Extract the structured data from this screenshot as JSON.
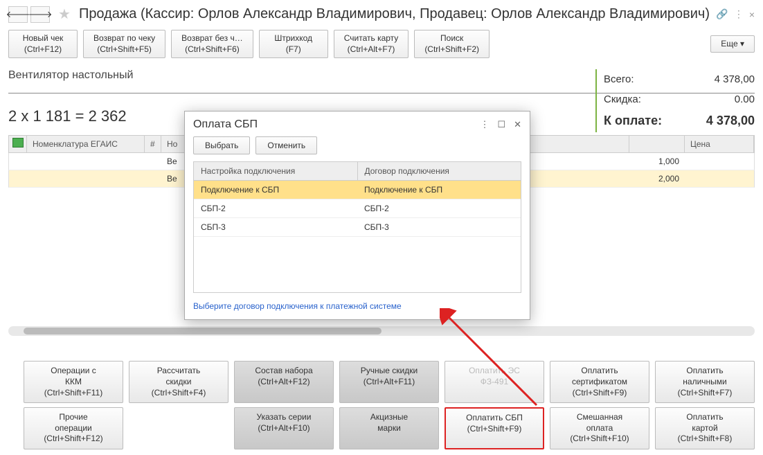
{
  "header": {
    "title": "Продажа (Кассир: Орлов Александр Владимирович, Продавец: Орлов Александр Владимирович)"
  },
  "toolbar": {
    "new_check": "Новый чек\n(Ctrl+F12)",
    "return_check": "Возврат по чеку\n(Ctrl+Shift+F5)",
    "return_no": "Возврат без ч…\n(Ctrl+Shift+F6)",
    "barcode": "Штрихкод\n(F7)",
    "card": "Считать карту\n(Ctrl+Alt+F7)",
    "search": "Поиск\n(Ctrl+Shift+F2)",
    "more": "Еще"
  },
  "item_name": "Вентилятор настольный",
  "calc": "2 x 1 181 = 2 362",
  "totals": {
    "total_label": "Всего:",
    "total_value": "4 378,00",
    "discount_label": "Скидка:",
    "discount_value": "0.00",
    "due_label": "К оплате:",
    "due_value": "4 378,00"
  },
  "table": {
    "col_nom": "Номенклатура ЕГАИС",
    "col_num": "#",
    "col_name": "Но",
    "col_price": "Цена",
    "rows": [
      {
        "name": "Ве",
        "qty": "1,000"
      },
      {
        "name": "Ве",
        "qty": "2,000"
      }
    ]
  },
  "dialog": {
    "title": "Оплата СБП",
    "select": "Выбрать",
    "cancel": "Отменить",
    "col1": "Настройка подключения",
    "col2": "Договор подключения",
    "rows": [
      {
        "c1": "Подключение к СБП",
        "c2": "Подключение к СБП"
      },
      {
        "c1": "СБП-2",
        "c2": "СБП-2"
      },
      {
        "c1": "СБП-3",
        "c2": "СБП-3"
      }
    ],
    "hint": "Выберите договор подключения к платежной системе"
  },
  "bottom": {
    "r1": [
      "Операции с\nККМ\n(Ctrl+Shift+F11)",
      "Рассчитать\nскидки\n(Ctrl+Shift+F4)",
      "Состав набора\n(Ctrl+Alt+F12)",
      "Ручные скидки\n(Ctrl+Alt+F11)",
      "Оплатить ЭС\nФЗ-491",
      "Оплатить\nсертификатом\n(Ctrl+Shift+F9)",
      "Оплатить\nналичными\n(Ctrl+Shift+F7)"
    ],
    "r2": [
      "Прочие\nоперации\n(Ctrl+Shift+F12)",
      "Указать серии\n(Ctrl+Alt+F10)",
      "Акцизные\nмарки",
      "Оплатить СБП\n(Ctrl+Shift+F9)",
      "Смешанная\nоплата\n(Ctrl+Shift+F10)",
      "Оплатить\nкартой\n(Ctrl+Shift+F8)"
    ]
  }
}
